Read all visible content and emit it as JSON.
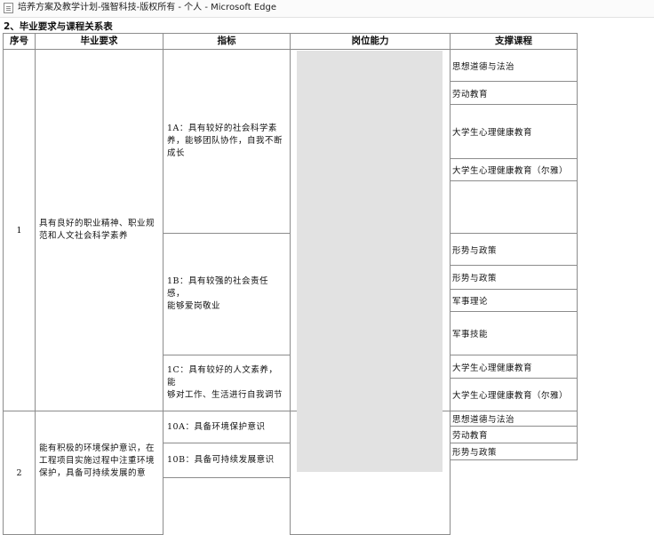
{
  "window": {
    "title": "培养方案及教学计划-强智科技-版权所有 - 个人 - Microsoft Edge"
  },
  "section_heading": "2、毕业要求与课程关系表",
  "table": {
    "headers": [
      "序号",
      "毕业要求",
      "指标",
      "岗位能力",
      "支撑课程"
    ],
    "rows": [
      {
        "no": "1",
        "requirement": "具有良好的职业精神、职业规\n范和人文社会科学素养",
        "indicators": [
          {
            "text": "1A：具有较好的社会科学素\n养，能够团队协作，自我不断\n成长",
            "courses": [
              "思想道德与法治",
              "劳动教育",
              "大学生心理健康教育",
              "大学生心理健康教育（尔雅）",
              ""
            ]
          },
          {
            "text": "1B：具有较强的社会责任感，\n能够爱岗敬业",
            "courses": [
              "形势与政策",
              "形势与政策",
              "军事理论",
              "军事技能"
            ]
          },
          {
            "text": "1C：具有较好的人文素养，能\n够对工作、生活进行自我调节",
            "courses": [
              "大学生心理健康教育",
              "大学生心理健康教育（尔雅）"
            ]
          }
        ]
      },
      {
        "no": "2",
        "requirement": "能有积极的环境保护意识，在\n工程项目实施过程中注重环境\n保护，具备可持续发展的意",
        "indicators": [
          {
            "text": "10A：具备环境保护意识",
            "courses": [
              "思想道德与法治",
              "劳动教育"
            ]
          },
          {
            "text": "10B：具备可持续发展意识",
            "courses": [
              "形势与政策"
            ]
          }
        ]
      }
    ]
  }
}
